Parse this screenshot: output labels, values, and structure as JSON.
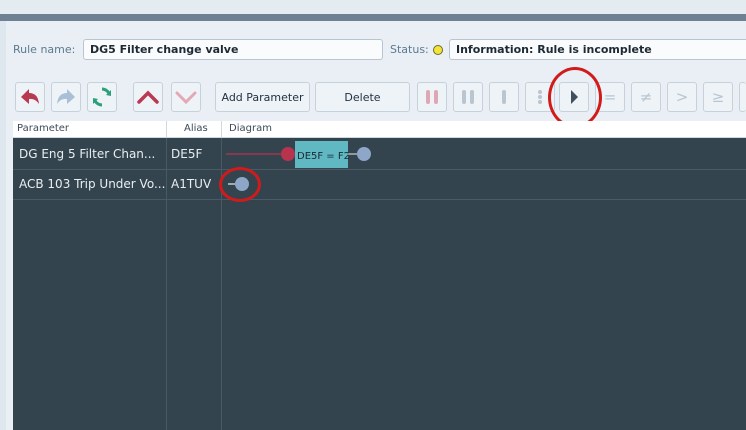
{
  "rule": {
    "label": "Rule name:",
    "value": "DG5 Filter change valve"
  },
  "status": {
    "label": "Status:",
    "value": "Information: Rule is incomplete",
    "dot_color": "#f4e43a"
  },
  "toolbar": {
    "undo_icon": "undo-arrow-icon",
    "redo_icon": "redo-arrow-icon",
    "refresh_icon": "refresh-icon",
    "move_up_icon": "chevron-up-icon",
    "move_down_icon": "chevron-down-icon",
    "add_parameter": "Add Parameter",
    "delete": "Delete",
    "eq_symbol": "=",
    "neq_symbol": "≠",
    "gt_symbol": ">",
    "ge_symbol": "≥"
  },
  "grid": {
    "headers": {
      "parameter": "Parameter",
      "alias": "Alias",
      "diagram": "Diagram"
    },
    "rows": [
      {
        "parameter": "DG Eng 5  Filter Chan...",
        "alias": "DE5F",
        "node_label": "DE5F = F2"
      },
      {
        "parameter": "ACB 103 Trip Under Vo...",
        "alias": "A1TUV"
      }
    ]
  },
  "colors": {
    "accent_red": "#d11b1b",
    "node_teal": "#5fb8c2",
    "node_blue": "#8ea6c8",
    "port_red": "#b8334d"
  }
}
